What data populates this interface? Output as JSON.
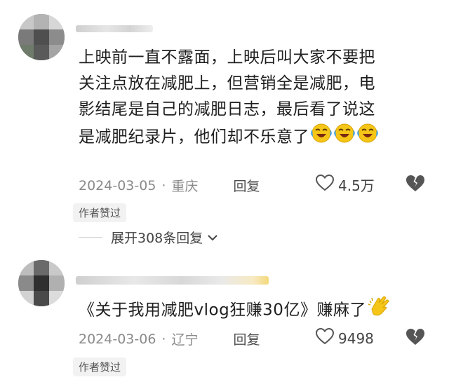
{
  "comments": [
    {
      "text_lines": [
        "上映前一直不露面，上映后叫大家不要把",
        "关注点放在减肥上，但营销全是减肥，电",
        "影结尾是自己的减肥日志，最后看了说这",
        "是减肥纪录片，他们却不乐意了"
      ],
      "emoji": [
        "laugh-cry",
        "laugh-cry",
        "laugh-cry"
      ],
      "date": "2024-03-05",
      "location": "重庆",
      "reply_label": "回复",
      "likes": "4.5万",
      "author_liked_label": "作者赞过",
      "expand_label": "展开308条回复"
    },
    {
      "text_lines": [
        "《关于我用减肥vlog狂赚30亿》赚麻了"
      ],
      "emoji": [
        "clapping-hands"
      ],
      "date": "2024-03-06",
      "location": "辽宁",
      "reply_label": "回复",
      "likes": "9498",
      "author_liked_label": "作者赞过"
    }
  ],
  "colors": {
    "meta_gray": "#8a8a8a",
    "emoji_yellow": "#f5c518",
    "tear_blue": "#3ba0e6"
  },
  "icons": [
    "heart-outline-icon",
    "broken-heart-icon",
    "chevron-down-icon"
  ]
}
